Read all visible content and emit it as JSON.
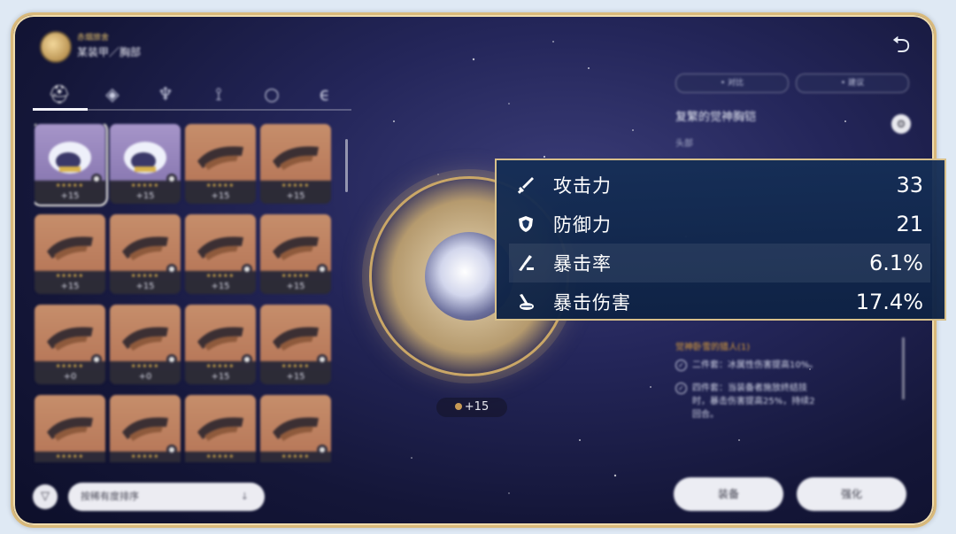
{
  "header": {
    "small_label": "赤烟旅舍",
    "title": "某装甲／胸部",
    "back_icon": "return-arrow-icon"
  },
  "tabs": [
    {
      "icon": "helmet-icon"
    },
    {
      "icon": "chest-icon"
    },
    {
      "icon": "cape-icon"
    },
    {
      "icon": "boots-icon"
    },
    {
      "icon": "ring-icon"
    },
    {
      "icon": "trinket-icon"
    }
  ],
  "items": [
    {
      "level": "+15",
      "type": "purple",
      "locked": true,
      "selected": true
    },
    {
      "level": "+15",
      "type": "purple",
      "locked": true
    },
    {
      "level": "+15",
      "type": "orange",
      "locked": false
    },
    {
      "level": "+15",
      "type": "orange",
      "locked": false
    },
    {
      "level": "+15",
      "type": "orange",
      "locked": false
    },
    {
      "level": "+15",
      "type": "orange",
      "locked": true
    },
    {
      "level": "+15",
      "type": "orange",
      "locked": true
    },
    {
      "level": "+15",
      "type": "orange",
      "locked": true
    },
    {
      "level": "+0",
      "type": "orange",
      "locked": true
    },
    {
      "level": "+0",
      "type": "orange",
      "locked": true
    },
    {
      "level": "+15",
      "type": "orange",
      "locked": true
    },
    {
      "level": "+15",
      "type": "orange",
      "locked": true
    },
    {
      "level": "",
      "type": "orange",
      "locked": false
    },
    {
      "level": "",
      "type": "orange",
      "locked": true
    },
    {
      "level": "",
      "type": "orange",
      "locked": false
    },
    {
      "level": "",
      "type": "orange",
      "locked": true
    }
  ],
  "sort": {
    "label": "按稀有度排序",
    "arrow": "↓"
  },
  "center": {
    "level_text": "+15"
  },
  "right_panel": {
    "btn_compare": "• 对比",
    "btn_recommend": "• 建议",
    "item_name": "复繁的觉神胸铠",
    "sub": "头部",
    "set_name": "觉神卧雪的猎人(1)",
    "set_bonus_2": "二件套：冰属性伤害提高10%。",
    "set_bonus_4a": "四件套：当装备者施放终结技",
    "set_bonus_4b": "时，暴击伤害提高25%，持续2",
    "set_bonus_4c": "回合。"
  },
  "actions": {
    "equip": "装备",
    "upgrade": "强化"
  },
  "stats": [
    {
      "icon": "sword-icon",
      "label": "攻击力",
      "value": "33"
    },
    {
      "icon": "shield-icon",
      "label": "防御力",
      "value": "21"
    },
    {
      "icon": "crit-rate-icon",
      "label": "暴击率",
      "value": "6.1%"
    },
    {
      "icon": "crit-damage-icon",
      "label": "暴击伤害",
      "value": "17.4%"
    }
  ],
  "colors": {
    "frame_border": "#d9b97a",
    "accent_gold": "#e0a23a",
    "stat_bg": "#152e56"
  }
}
